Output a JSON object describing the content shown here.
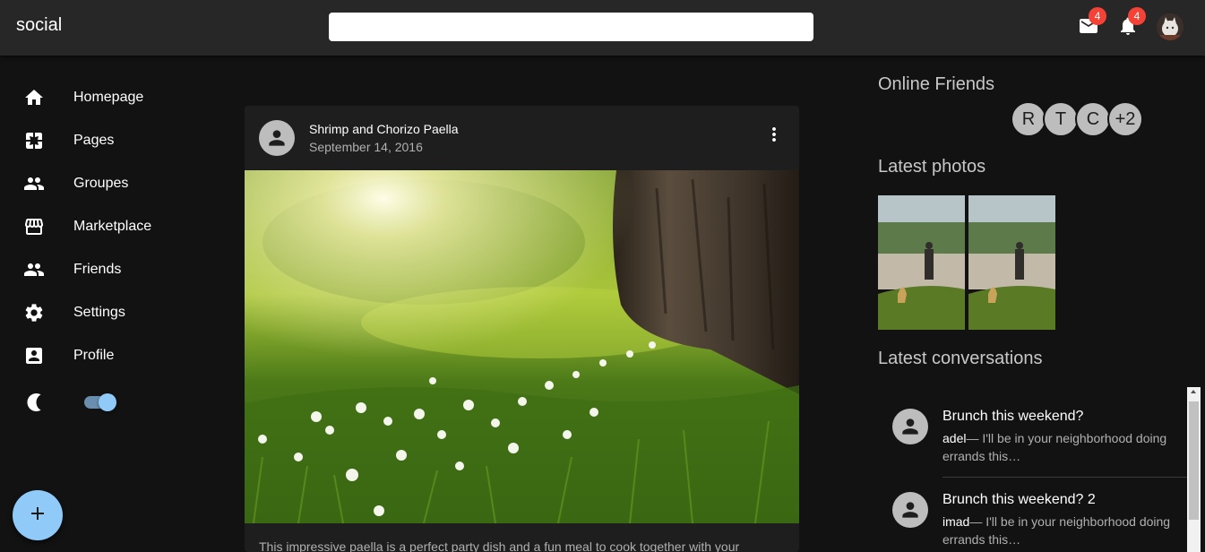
{
  "app": {
    "brand": "social"
  },
  "search": {
    "placeholder": ""
  },
  "header": {
    "mail_badge": "4",
    "notifications_badge": "4"
  },
  "sidebar": {
    "items": [
      {
        "label": "Homepage",
        "icon": "home-icon"
      },
      {
        "label": "Pages",
        "icon": "pages-icon"
      },
      {
        "label": "Groupes",
        "icon": "groups-icon"
      },
      {
        "label": "Marketplace",
        "icon": "store-icon"
      },
      {
        "label": "Friends",
        "icon": "friends-icon"
      },
      {
        "label": "Settings",
        "icon": "gear-icon"
      },
      {
        "label": "Profile",
        "icon": "profile-icon"
      }
    ],
    "theme_toggle": {
      "icon": "moon-icon",
      "checked": true
    }
  },
  "fab": {
    "icon": "plus-icon",
    "label": "+"
  },
  "post": {
    "title": "Shrimp and Chorizo Paella",
    "date": "September 14, 2016",
    "text": "This impressive paella is a perfect party dish and a fun meal to cook together with your"
  },
  "right": {
    "online_title": "Online Friends",
    "online_friends": [
      "R",
      "T",
      "C",
      "+2"
    ],
    "photos_title": "Latest photos",
    "conversations_title": "Latest conversations",
    "conversations": [
      {
        "title": "Brunch this weekend?",
        "author": "adel",
        "preview": "— I'll be in your neighborhood doing errands this…"
      },
      {
        "title": "Brunch this weekend? 2",
        "author": "imad",
        "preview": "— I'll be in your neighborhood doing errands this…"
      }
    ]
  },
  "colors": {
    "accent": "#90caf9",
    "badge": "#f44336",
    "appbar": "#272727",
    "background": "#121212",
    "card": "#1e1e1e"
  }
}
